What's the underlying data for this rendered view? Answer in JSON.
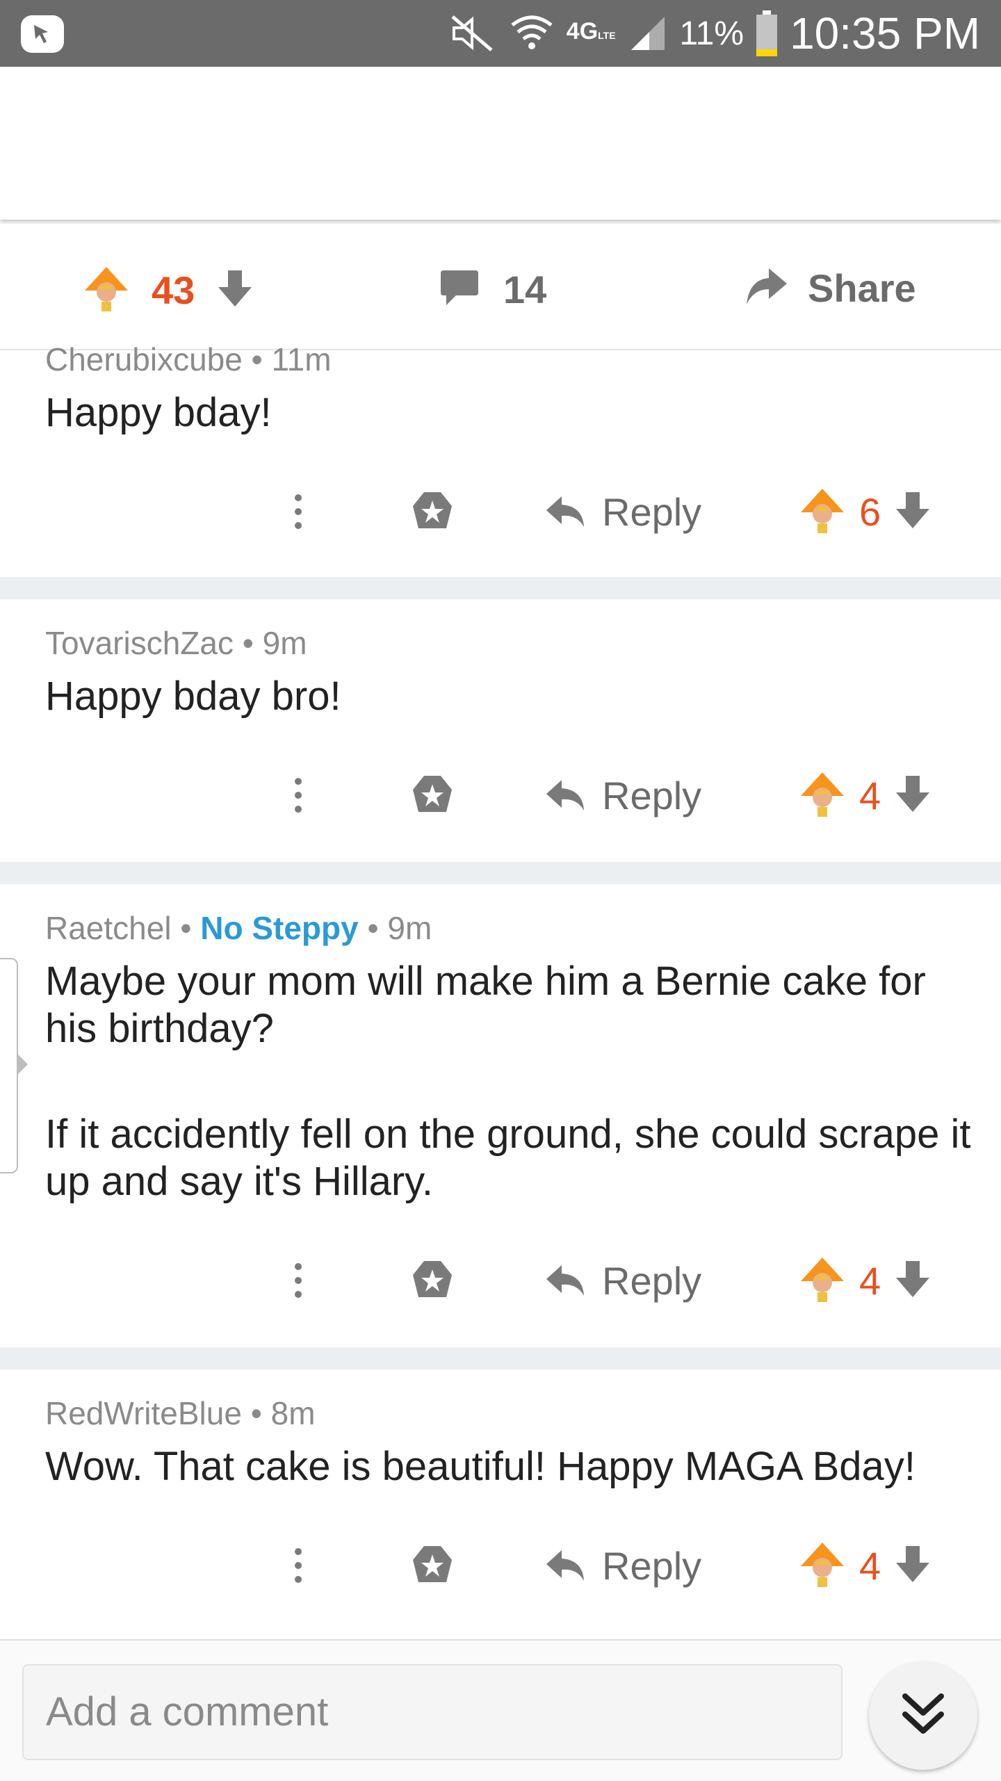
{
  "status_bar": {
    "battery": "11%",
    "time": "10:35 PM",
    "network": "4G",
    "network_sub": "LTE"
  },
  "post_actions": {
    "score": "43",
    "comments_count": "14",
    "share_label": "Share"
  },
  "comments": [
    {
      "author": "Cherubixcube",
      "flair": "",
      "age": "11m",
      "body": [
        "Happy bday!"
      ],
      "score": "6",
      "reply_label": "Reply"
    },
    {
      "author": "TovarischZac",
      "flair": "",
      "age": "9m",
      "body": [
        "Happy bday bro!"
      ],
      "score": "4",
      "reply_label": "Reply"
    },
    {
      "author": "Raetchel",
      "flair": "No Steppy",
      "age": "9m",
      "body": [
        "Maybe your mom will make him a Bernie cake for his birthday?",
        "If it accidently fell on the ground, she could scrape it up and say it's Hillary."
      ],
      "score": "4",
      "reply_label": "Reply"
    },
    {
      "author": "RedWriteBlue",
      "flair": "",
      "age": "8m",
      "body": [
        "Wow.  That cake is beautiful!  Happy MAGA Bday!"
      ],
      "score": "4",
      "reply_label": "Reply"
    }
  ],
  "composer": {
    "placeholder": "Add a comment"
  },
  "colors": {
    "accent_orange": "#e8501e",
    "flair_blue": "#2a9ad6",
    "icon_gray": "#6b6b6b"
  }
}
